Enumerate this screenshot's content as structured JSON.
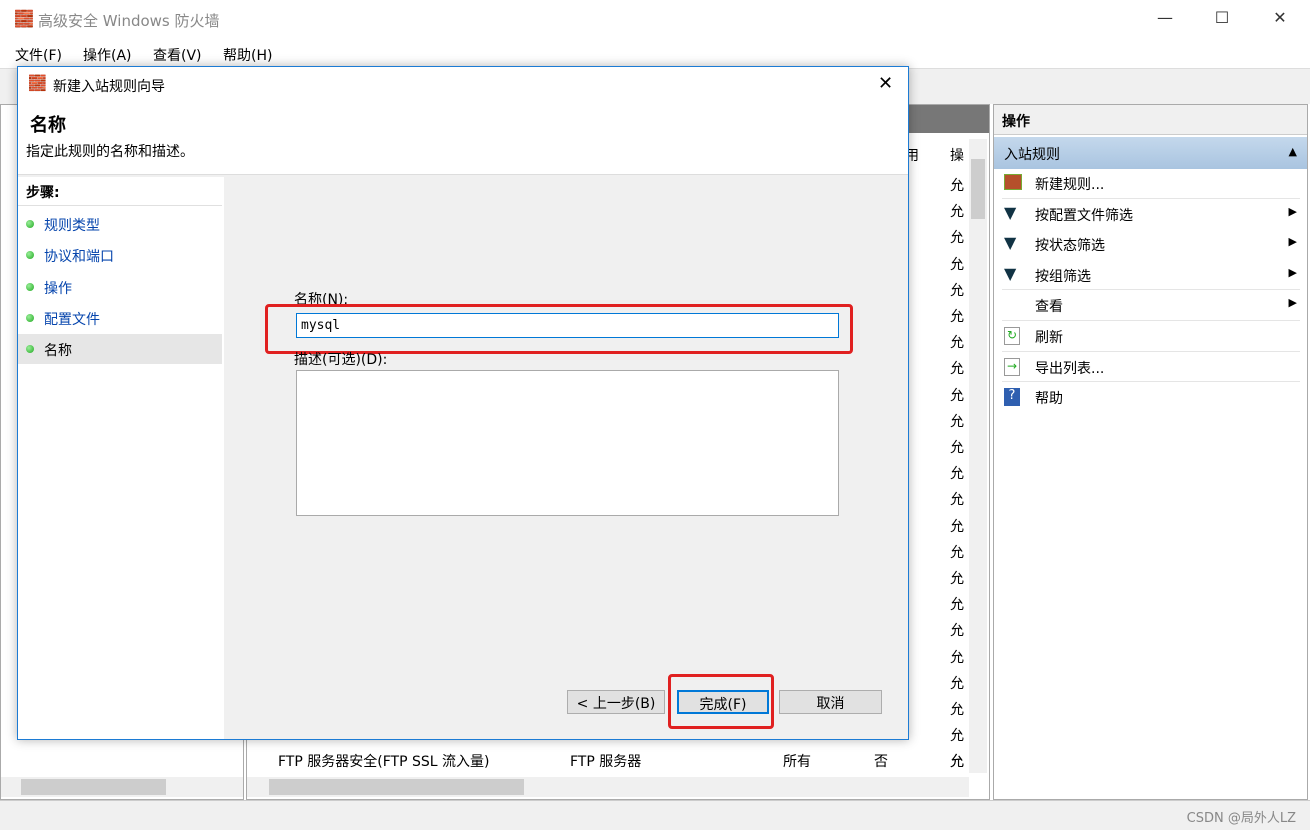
{
  "window": {
    "title": "高级安全 Windows 防火墙",
    "controls": [
      "—",
      "☐",
      "✕"
    ]
  },
  "menu": [
    "文件(F)",
    "操作(A)",
    "查看(V)",
    "帮助(H)"
  ],
  "center": {
    "col_headers": [
      "用",
      "操"
    ],
    "action_values": [
      "允",
      "允",
      "允",
      "允",
      "允",
      "允",
      "允",
      "允",
      "允",
      "允",
      "允",
      "允",
      "允",
      "允",
      "允",
      "允",
      "允",
      "允",
      "允",
      "允",
      "允",
      "允",
      "允",
      "允"
    ],
    "last_row": {
      "name": "FTP 服务器安全(FTP SSL 流入量)",
      "group": "FTP 服务器",
      "profile": "所有",
      "enabled": "否",
      "action": "允"
    }
  },
  "actions": {
    "title": "操作",
    "section": "入站规则",
    "items": [
      {
        "label": "新建规则...",
        "icon": "new-rule-icon",
        "submenu": false
      },
      {
        "label": "按配置文件筛选",
        "icon": "filter-icon",
        "submenu": true
      },
      {
        "label": "按状态筛选",
        "icon": "filter-icon",
        "submenu": true
      },
      {
        "label": "按组筛选",
        "icon": "filter-icon",
        "submenu": true
      },
      {
        "label": "查看",
        "icon": "",
        "submenu": true
      },
      {
        "label": "刷新",
        "icon": "refresh-icon",
        "submenu": false
      },
      {
        "label": "导出列表...",
        "icon": "export-icon",
        "submenu": false
      },
      {
        "label": "帮助",
        "icon": "help-icon",
        "submenu": false
      }
    ]
  },
  "dialog": {
    "title": "新建入站规则向导",
    "heading": "名称",
    "subheading": "指定此规则的名称和描述。",
    "steps_label": "步骤:",
    "steps": [
      "规则类型",
      "协议和端口",
      "操作",
      "配置文件",
      "名称"
    ],
    "current_step": 4,
    "name_label": "名称(N):",
    "name_value": "mysql",
    "desc_label": "描述(可选)(D):",
    "desc_value": "",
    "back": "< 上一步(B)",
    "finish": "完成(F)",
    "cancel": "取消"
  },
  "watermark": "CSDN @局外人LZ",
  "colors": {
    "highlight": "#e02020",
    "accent": "#1c7bd4"
  }
}
